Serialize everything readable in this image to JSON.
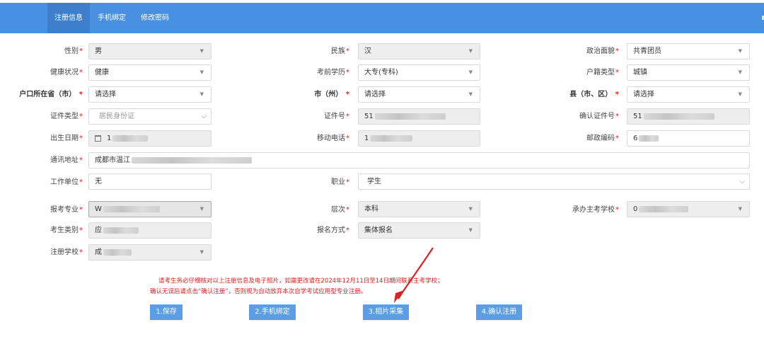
{
  "nav": {
    "tabs": [
      {
        "label": "注册信息",
        "active": true
      },
      {
        "label": "手机绑定",
        "active": false
      },
      {
        "label": "修改密码",
        "active": false
      }
    ]
  },
  "form": {
    "gender": {
      "label": "性别",
      "value": "男"
    },
    "ethnicity": {
      "label": "民族",
      "value": "汉"
    },
    "political": {
      "label": "政治面貌",
      "value": "共青团员"
    },
    "health": {
      "label": "健康状况",
      "value": "健康"
    },
    "education": {
      "label": "考前学历",
      "value": "大专(专科)"
    },
    "hukou_type": {
      "label": "户籍类型",
      "value": "城镇"
    },
    "province": {
      "label": "户口所在省（市）",
      "value": "请选择"
    },
    "city": {
      "label": "市（州）",
      "value": "请选择"
    },
    "county": {
      "label": "县（市、区）",
      "value": "请选择"
    },
    "id_type": {
      "label": "证件类型",
      "value": "居民身份证"
    },
    "id_number": {
      "label": "证件号",
      "value": "51"
    },
    "id_confirm": {
      "label": "确认证件号",
      "value": "51"
    },
    "birth_date": {
      "label": "出生日期",
      "value": "1"
    },
    "mobile": {
      "label": "移动电话",
      "value": "1"
    },
    "postcode": {
      "label": "邮政编码",
      "value": "6"
    },
    "address": {
      "label": "通讯地址",
      "value": "成都市温江"
    },
    "workplace": {
      "label": "工作单位",
      "value": "无"
    },
    "occupation": {
      "label": "职业",
      "value": "学生"
    },
    "major": {
      "label": "报考专业",
      "value": "W"
    },
    "level": {
      "label": "层次",
      "value": "本科"
    },
    "host_school": {
      "label": "承办主考学校",
      "value": "0"
    },
    "candidate_type": {
      "label": "考生类别",
      "value": "应"
    },
    "reg_method": {
      "label": "报名方式",
      "value": "集体报名"
    },
    "reg_school": {
      "label": "注册学校",
      "value": "成"
    }
  },
  "notice": {
    "line1": "请考生务必仔细核对以上注册信息及电子照片，如需更改请在2024年12月11日至14日期间联系主考学校；",
    "line2": "确认无误后请点击“确认注册”，否则视为自动放弃本次自学考试应用型专业注册。"
  },
  "buttons": {
    "save": "1.保存",
    "bind_phone": "2.手机绑定",
    "photo": "3.相片采集",
    "confirm": "4.确认注册"
  },
  "colors": {
    "topbar": "#4a90e2",
    "button": "#5b9ee6",
    "required": "#e02020",
    "arrow": "#e02020"
  }
}
